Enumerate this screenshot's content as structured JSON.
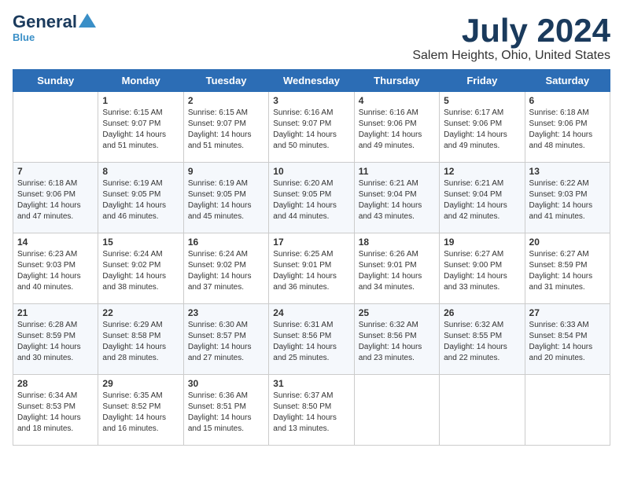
{
  "header": {
    "logo_line1": "General",
    "logo_line2": "Blue",
    "month": "July 2024",
    "location": "Salem Heights, Ohio, United States"
  },
  "weekdays": [
    "Sunday",
    "Monday",
    "Tuesday",
    "Wednesday",
    "Thursday",
    "Friday",
    "Saturday"
  ],
  "weeks": [
    [
      {
        "day": "",
        "sunrise": "",
        "sunset": "",
        "daylight": ""
      },
      {
        "day": "1",
        "sunrise": "Sunrise: 6:15 AM",
        "sunset": "Sunset: 9:07 PM",
        "daylight": "Daylight: 14 hours and 51 minutes."
      },
      {
        "day": "2",
        "sunrise": "Sunrise: 6:15 AM",
        "sunset": "Sunset: 9:07 PM",
        "daylight": "Daylight: 14 hours and 51 minutes."
      },
      {
        "day": "3",
        "sunrise": "Sunrise: 6:16 AM",
        "sunset": "Sunset: 9:07 PM",
        "daylight": "Daylight: 14 hours and 50 minutes."
      },
      {
        "day": "4",
        "sunrise": "Sunrise: 6:16 AM",
        "sunset": "Sunset: 9:06 PM",
        "daylight": "Daylight: 14 hours and 49 minutes."
      },
      {
        "day": "5",
        "sunrise": "Sunrise: 6:17 AM",
        "sunset": "Sunset: 9:06 PM",
        "daylight": "Daylight: 14 hours and 49 minutes."
      },
      {
        "day": "6",
        "sunrise": "Sunrise: 6:18 AM",
        "sunset": "Sunset: 9:06 PM",
        "daylight": "Daylight: 14 hours and 48 minutes."
      }
    ],
    [
      {
        "day": "7",
        "sunrise": "Sunrise: 6:18 AM",
        "sunset": "Sunset: 9:06 PM",
        "daylight": "Daylight: 14 hours and 47 minutes."
      },
      {
        "day": "8",
        "sunrise": "Sunrise: 6:19 AM",
        "sunset": "Sunset: 9:05 PM",
        "daylight": "Daylight: 14 hours and 46 minutes."
      },
      {
        "day": "9",
        "sunrise": "Sunrise: 6:19 AM",
        "sunset": "Sunset: 9:05 PM",
        "daylight": "Daylight: 14 hours and 45 minutes."
      },
      {
        "day": "10",
        "sunrise": "Sunrise: 6:20 AM",
        "sunset": "Sunset: 9:05 PM",
        "daylight": "Daylight: 14 hours and 44 minutes."
      },
      {
        "day": "11",
        "sunrise": "Sunrise: 6:21 AM",
        "sunset": "Sunset: 9:04 PM",
        "daylight": "Daylight: 14 hours and 43 minutes."
      },
      {
        "day": "12",
        "sunrise": "Sunrise: 6:21 AM",
        "sunset": "Sunset: 9:04 PM",
        "daylight": "Daylight: 14 hours and 42 minutes."
      },
      {
        "day": "13",
        "sunrise": "Sunrise: 6:22 AM",
        "sunset": "Sunset: 9:03 PM",
        "daylight": "Daylight: 14 hours and 41 minutes."
      }
    ],
    [
      {
        "day": "14",
        "sunrise": "Sunrise: 6:23 AM",
        "sunset": "Sunset: 9:03 PM",
        "daylight": "Daylight: 14 hours and 40 minutes."
      },
      {
        "day": "15",
        "sunrise": "Sunrise: 6:24 AM",
        "sunset": "Sunset: 9:02 PM",
        "daylight": "Daylight: 14 hours and 38 minutes."
      },
      {
        "day": "16",
        "sunrise": "Sunrise: 6:24 AM",
        "sunset": "Sunset: 9:02 PM",
        "daylight": "Daylight: 14 hours and 37 minutes."
      },
      {
        "day": "17",
        "sunrise": "Sunrise: 6:25 AM",
        "sunset": "Sunset: 9:01 PM",
        "daylight": "Daylight: 14 hours and 36 minutes."
      },
      {
        "day": "18",
        "sunrise": "Sunrise: 6:26 AM",
        "sunset": "Sunset: 9:01 PM",
        "daylight": "Daylight: 14 hours and 34 minutes."
      },
      {
        "day": "19",
        "sunrise": "Sunrise: 6:27 AM",
        "sunset": "Sunset: 9:00 PM",
        "daylight": "Daylight: 14 hours and 33 minutes."
      },
      {
        "day": "20",
        "sunrise": "Sunrise: 6:27 AM",
        "sunset": "Sunset: 8:59 PM",
        "daylight": "Daylight: 14 hours and 31 minutes."
      }
    ],
    [
      {
        "day": "21",
        "sunrise": "Sunrise: 6:28 AM",
        "sunset": "Sunset: 8:59 PM",
        "daylight": "Daylight: 14 hours and 30 minutes."
      },
      {
        "day": "22",
        "sunrise": "Sunrise: 6:29 AM",
        "sunset": "Sunset: 8:58 PM",
        "daylight": "Daylight: 14 hours and 28 minutes."
      },
      {
        "day": "23",
        "sunrise": "Sunrise: 6:30 AM",
        "sunset": "Sunset: 8:57 PM",
        "daylight": "Daylight: 14 hours and 27 minutes."
      },
      {
        "day": "24",
        "sunrise": "Sunrise: 6:31 AM",
        "sunset": "Sunset: 8:56 PM",
        "daylight": "Daylight: 14 hours and 25 minutes."
      },
      {
        "day": "25",
        "sunrise": "Sunrise: 6:32 AM",
        "sunset": "Sunset: 8:56 PM",
        "daylight": "Daylight: 14 hours and 23 minutes."
      },
      {
        "day": "26",
        "sunrise": "Sunrise: 6:32 AM",
        "sunset": "Sunset: 8:55 PM",
        "daylight": "Daylight: 14 hours and 22 minutes."
      },
      {
        "day": "27",
        "sunrise": "Sunrise: 6:33 AM",
        "sunset": "Sunset: 8:54 PM",
        "daylight": "Daylight: 14 hours and 20 minutes."
      }
    ],
    [
      {
        "day": "28",
        "sunrise": "Sunrise: 6:34 AM",
        "sunset": "Sunset: 8:53 PM",
        "daylight": "Daylight: 14 hours and 18 minutes."
      },
      {
        "day": "29",
        "sunrise": "Sunrise: 6:35 AM",
        "sunset": "Sunset: 8:52 PM",
        "daylight": "Daylight: 14 hours and 16 minutes."
      },
      {
        "day": "30",
        "sunrise": "Sunrise: 6:36 AM",
        "sunset": "Sunset: 8:51 PM",
        "daylight": "Daylight: 14 hours and 15 minutes."
      },
      {
        "day": "31",
        "sunrise": "Sunrise: 6:37 AM",
        "sunset": "Sunset: 8:50 PM",
        "daylight": "Daylight: 14 hours and 13 minutes."
      },
      {
        "day": "",
        "sunrise": "",
        "sunset": "",
        "daylight": ""
      },
      {
        "day": "",
        "sunrise": "",
        "sunset": "",
        "daylight": ""
      },
      {
        "day": "",
        "sunrise": "",
        "sunset": "",
        "daylight": ""
      }
    ]
  ]
}
